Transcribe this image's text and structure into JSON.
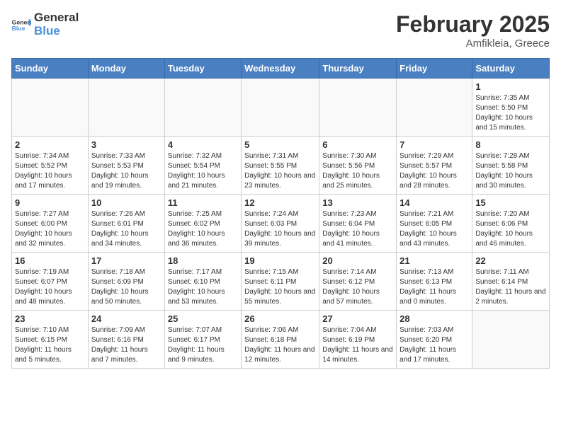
{
  "header": {
    "logo_general": "General",
    "logo_blue": "Blue",
    "month_year": "February 2025",
    "location": "Amfikleia, Greece"
  },
  "days_of_week": [
    "Sunday",
    "Monday",
    "Tuesday",
    "Wednesday",
    "Thursday",
    "Friday",
    "Saturday"
  ],
  "weeks": [
    [
      {
        "day": "",
        "info": ""
      },
      {
        "day": "",
        "info": ""
      },
      {
        "day": "",
        "info": ""
      },
      {
        "day": "",
        "info": ""
      },
      {
        "day": "",
        "info": ""
      },
      {
        "day": "",
        "info": ""
      },
      {
        "day": "1",
        "info": "Sunrise: 7:35 AM\nSunset: 5:50 PM\nDaylight: 10 hours and 15 minutes."
      }
    ],
    [
      {
        "day": "2",
        "info": "Sunrise: 7:34 AM\nSunset: 5:52 PM\nDaylight: 10 hours and 17 minutes."
      },
      {
        "day": "3",
        "info": "Sunrise: 7:33 AM\nSunset: 5:53 PM\nDaylight: 10 hours and 19 minutes."
      },
      {
        "day": "4",
        "info": "Sunrise: 7:32 AM\nSunset: 5:54 PM\nDaylight: 10 hours and 21 minutes."
      },
      {
        "day": "5",
        "info": "Sunrise: 7:31 AM\nSunset: 5:55 PM\nDaylight: 10 hours and 23 minutes."
      },
      {
        "day": "6",
        "info": "Sunrise: 7:30 AM\nSunset: 5:56 PM\nDaylight: 10 hours and 25 minutes."
      },
      {
        "day": "7",
        "info": "Sunrise: 7:29 AM\nSunset: 5:57 PM\nDaylight: 10 hours and 28 minutes."
      },
      {
        "day": "8",
        "info": "Sunrise: 7:28 AM\nSunset: 5:58 PM\nDaylight: 10 hours and 30 minutes."
      }
    ],
    [
      {
        "day": "9",
        "info": "Sunrise: 7:27 AM\nSunset: 6:00 PM\nDaylight: 10 hours and 32 minutes."
      },
      {
        "day": "10",
        "info": "Sunrise: 7:26 AM\nSunset: 6:01 PM\nDaylight: 10 hours and 34 minutes."
      },
      {
        "day": "11",
        "info": "Sunrise: 7:25 AM\nSunset: 6:02 PM\nDaylight: 10 hours and 36 minutes."
      },
      {
        "day": "12",
        "info": "Sunrise: 7:24 AM\nSunset: 6:03 PM\nDaylight: 10 hours and 39 minutes."
      },
      {
        "day": "13",
        "info": "Sunrise: 7:23 AM\nSunset: 6:04 PM\nDaylight: 10 hours and 41 minutes."
      },
      {
        "day": "14",
        "info": "Sunrise: 7:21 AM\nSunset: 6:05 PM\nDaylight: 10 hours and 43 minutes."
      },
      {
        "day": "15",
        "info": "Sunrise: 7:20 AM\nSunset: 6:06 PM\nDaylight: 10 hours and 46 minutes."
      }
    ],
    [
      {
        "day": "16",
        "info": "Sunrise: 7:19 AM\nSunset: 6:07 PM\nDaylight: 10 hours and 48 minutes."
      },
      {
        "day": "17",
        "info": "Sunrise: 7:18 AM\nSunset: 6:09 PM\nDaylight: 10 hours and 50 minutes."
      },
      {
        "day": "18",
        "info": "Sunrise: 7:17 AM\nSunset: 6:10 PM\nDaylight: 10 hours and 53 minutes."
      },
      {
        "day": "19",
        "info": "Sunrise: 7:15 AM\nSunset: 6:11 PM\nDaylight: 10 hours and 55 minutes."
      },
      {
        "day": "20",
        "info": "Sunrise: 7:14 AM\nSunset: 6:12 PM\nDaylight: 10 hours and 57 minutes."
      },
      {
        "day": "21",
        "info": "Sunrise: 7:13 AM\nSunset: 6:13 PM\nDaylight: 11 hours and 0 minutes."
      },
      {
        "day": "22",
        "info": "Sunrise: 7:11 AM\nSunset: 6:14 PM\nDaylight: 11 hours and 2 minutes."
      }
    ],
    [
      {
        "day": "23",
        "info": "Sunrise: 7:10 AM\nSunset: 6:15 PM\nDaylight: 11 hours and 5 minutes."
      },
      {
        "day": "24",
        "info": "Sunrise: 7:09 AM\nSunset: 6:16 PM\nDaylight: 11 hours and 7 minutes."
      },
      {
        "day": "25",
        "info": "Sunrise: 7:07 AM\nSunset: 6:17 PM\nDaylight: 11 hours and 9 minutes."
      },
      {
        "day": "26",
        "info": "Sunrise: 7:06 AM\nSunset: 6:18 PM\nDaylight: 11 hours and 12 minutes."
      },
      {
        "day": "27",
        "info": "Sunrise: 7:04 AM\nSunset: 6:19 PM\nDaylight: 11 hours and 14 minutes."
      },
      {
        "day": "28",
        "info": "Sunrise: 7:03 AM\nSunset: 6:20 PM\nDaylight: 11 hours and 17 minutes."
      },
      {
        "day": "",
        "info": ""
      }
    ]
  ]
}
